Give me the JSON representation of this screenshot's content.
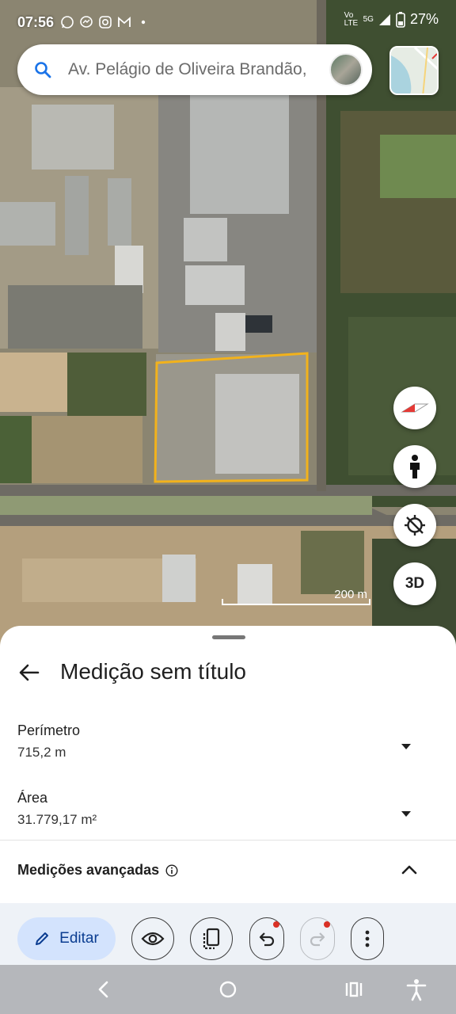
{
  "status_bar": {
    "time": "07:56",
    "network": "5G",
    "network_sub": "Vo LTE",
    "battery": "27%"
  },
  "search": {
    "value": "Av. Pelágio de Oliveira Brandão,",
    "icon": "search-icon"
  },
  "map": {
    "scale_label": "200 m",
    "three_d_label": "3D",
    "measure_outline_color": "#f2b21c"
  },
  "sheet": {
    "title": "Medição sem título",
    "perimeter": {
      "label": "Perímetro",
      "value": "715,2 m"
    },
    "area": {
      "label": "Área",
      "value": "31.779,17 m²"
    },
    "advanced": {
      "label": "Medições avançadas"
    }
  },
  "toolbar": {
    "edit_label": "Editar",
    "accent": "#d3e3fd"
  }
}
